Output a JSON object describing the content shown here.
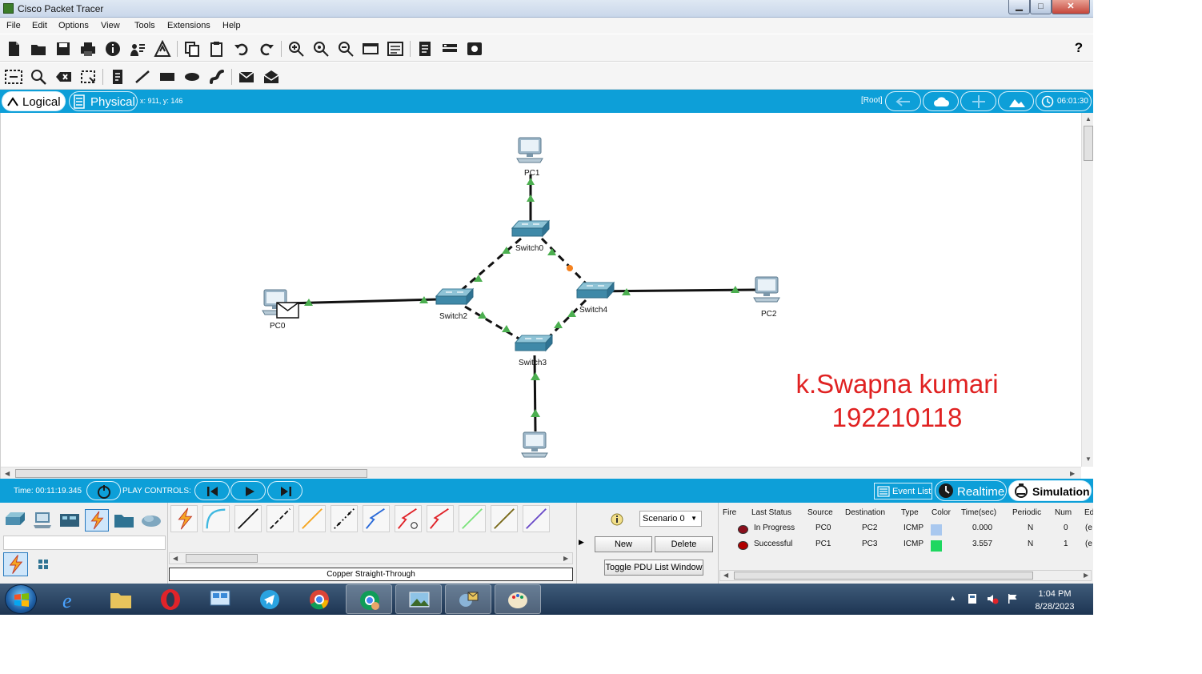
{
  "window": {
    "title": "Cisco Packet Tracer"
  },
  "menu": [
    "File",
    "Edit",
    "Options",
    "View",
    "Tools",
    "Extensions",
    "Help"
  ],
  "toolbar": {
    "help_label": "?"
  },
  "workspace_bar": {
    "logical_label": "Logical",
    "physical_label": "Physical",
    "coords": "x: 911, y: 146",
    "root_label": "[Root]",
    "clock": "06:01:30"
  },
  "network": {
    "devices": [
      {
        "id": "pc1",
        "label": "PC1"
      },
      {
        "id": "switch0",
        "label": "Switch0"
      },
      {
        "id": "pc0",
        "label": "PC0"
      },
      {
        "id": "switch2",
        "label": "Switch2"
      },
      {
        "id": "switch4",
        "label": "Switch4"
      },
      {
        "id": "pc2",
        "label": "PC2"
      },
      {
        "id": "switch3",
        "label": "Switch3"
      }
    ]
  },
  "watermark": {
    "line1": "k.Swapna kumari",
    "line2": "192210118"
  },
  "simbar": {
    "time": "Time: 00:11:19.345",
    "play_controls": "PLAY CONTROLS:",
    "event_list": "Event List",
    "realtime": "Realtime",
    "simulation": "Simulation"
  },
  "connections": {
    "selected_name": "Copper Straight-Through"
  },
  "scenario": {
    "selected": "Scenario 0",
    "new_label": "New",
    "delete_label": "Delete",
    "toggle_label": "Toggle PDU List Window"
  },
  "events": {
    "columns": [
      "Fire",
      "Last Status",
      "Source",
      "Destination",
      "Type",
      "Color",
      "Time(sec)",
      "Periodic",
      "Num",
      "Ed"
    ],
    "rows": [
      {
        "last_status": "In Progress",
        "source": "PC0",
        "destination": "PC2",
        "type": "ICMP",
        "color": "#a9c8ef",
        "time": "0.000",
        "periodic": "N",
        "num": "0",
        "edit": "(e"
      },
      {
        "last_status": "Successful",
        "source": "PC1",
        "destination": "PC3",
        "type": "ICMP",
        "color": "#1ed760",
        "time": "3.557",
        "periodic": "N",
        "num": "1",
        "edit": "(e"
      }
    ]
  },
  "taskbar": {
    "time": "1:04 PM",
    "date": "8/28/2023"
  },
  "colors": {
    "accent": "#0d9fd8",
    "link_up": "#4caf50",
    "link_pending": "#f5821f",
    "watermark": "#e02222"
  }
}
